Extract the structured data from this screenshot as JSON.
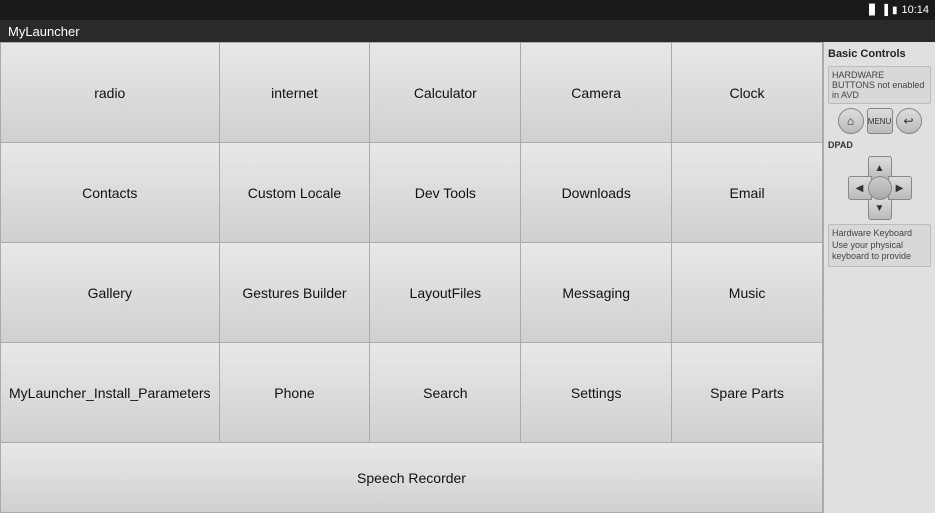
{
  "status_bar": {
    "left_text": "",
    "time": "10:14",
    "icons": [
      "wifi",
      "signal",
      "battery"
    ]
  },
  "title_bar": {
    "title": "MyLauncher"
  },
  "app_grid": {
    "items": [
      {
        "label": "radio",
        "row": 1,
        "col": 1
      },
      {
        "label": "internet",
        "row": 1,
        "col": 2
      },
      {
        "label": "Calculator",
        "row": 1,
        "col": 3
      },
      {
        "label": "Camera",
        "row": 1,
        "col": 4
      },
      {
        "label": "Clock",
        "row": 1,
        "col": 5
      },
      {
        "label": "Contacts",
        "row": 2,
        "col": 1
      },
      {
        "label": "Custom Locale",
        "row": 2,
        "col": 2
      },
      {
        "label": "Dev Tools",
        "row": 2,
        "col": 3
      },
      {
        "label": "Downloads",
        "row": 2,
        "col": 4
      },
      {
        "label": "Email",
        "row": 2,
        "col": 5
      },
      {
        "label": "Gallery",
        "row": 3,
        "col": 1
      },
      {
        "label": "Gestures Builder",
        "row": 3,
        "col": 2
      },
      {
        "label": "LayoutFiles",
        "row": 3,
        "col": 3
      },
      {
        "label": "Messaging",
        "row": 3,
        "col": 4
      },
      {
        "label": "Music",
        "row": 3,
        "col": 5
      },
      {
        "label": "MyLauncher_Install_Parameters",
        "row": 4,
        "col": 1
      },
      {
        "label": "Phone",
        "row": 4,
        "col": 2
      },
      {
        "label": "Search",
        "row": 4,
        "col": 3
      },
      {
        "label": "Settings",
        "row": 4,
        "col": 4
      },
      {
        "label": "Spare Parts",
        "row": 4,
        "col": 5
      }
    ],
    "bottom_item": "Speech Recorder"
  },
  "right_panel": {
    "title": "Basic Controls",
    "hardware_buttons_label": "HARDWARE BUTTONS",
    "hardware_buttons_note": "not enabled in AVD",
    "btn_home": "⌂",
    "btn_menu": "MENU",
    "btn_back": "↩",
    "dpad_label": "DPAD",
    "dpad_up": "▲",
    "dpad_down": "▼",
    "dpad_left": "◀",
    "dpad_right": "▶",
    "dpad_center": "",
    "keyboard_label": "Hardware Keyboard",
    "keyboard_note": "Use your physical keyboard to provide"
  }
}
